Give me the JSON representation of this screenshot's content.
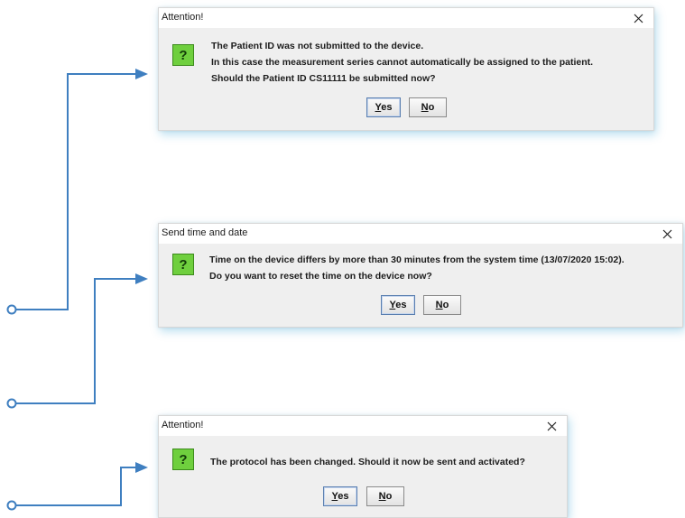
{
  "colors": {
    "connector": "#3f7fc0",
    "icon_green": "#6fcf3e"
  },
  "dialogs": [
    {
      "title": "Attention!",
      "icon": "question-icon",
      "lines": [
        "The Patient ID was not submitted to the device.",
        "In this case the measurement series cannot automatically be assigned to the patient.",
        "Should the Patient ID CS11111 be submitted now?"
      ],
      "yes": "Yes",
      "no": "No"
    },
    {
      "title": "Send time and date",
      "icon": "question-icon",
      "lines": [
        "Time on the device differs by more than 30 minutes from the system time (13/07/2020 15:02).",
        "Do you want to reset the time on the device now?"
      ],
      "yes": "Yes",
      "no": "No"
    },
    {
      "title": "Attention!",
      "icon": "question-icon",
      "lines": [
        "The protocol has been changed. Should it now be sent and activated?"
      ],
      "yes": "Yes",
      "no": "No"
    }
  ]
}
